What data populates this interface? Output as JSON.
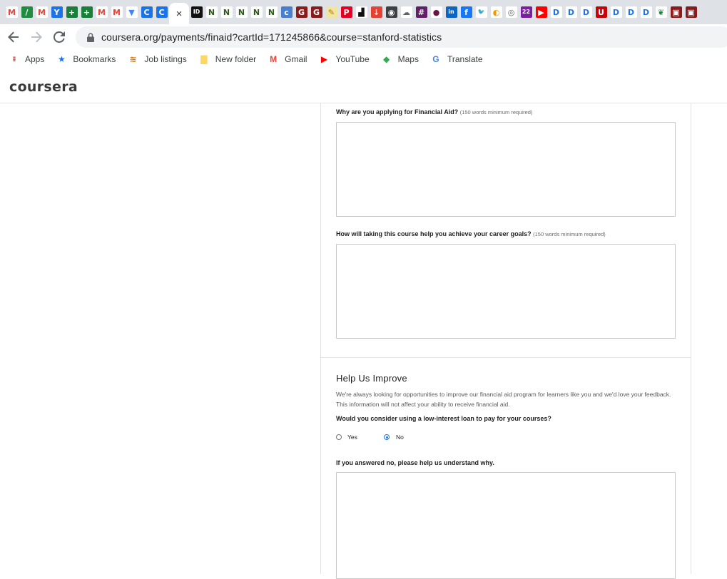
{
  "browser": {
    "tabs": [
      {
        "icon": "gmail-icon",
        "glyph": "M",
        "bg": "#ffffff",
        "fg": "#ea4335"
      },
      {
        "icon": "pen-icon",
        "glyph": "/",
        "bg": "#1e8e3e",
        "fg": "#ffffff"
      },
      {
        "icon": "gmail-icon",
        "glyph": "M",
        "bg": "#ffffff",
        "fg": "#ea4335"
      },
      {
        "icon": "y-icon",
        "glyph": "Y",
        "bg": "#1a73e8",
        "fg": "#ffffff"
      },
      {
        "icon": "plus-green-icon",
        "glyph": "+",
        "bg": "#188038",
        "fg": "#ffffff"
      },
      {
        "icon": "plus-green-icon",
        "glyph": "+",
        "bg": "#188038",
        "fg": "#ffffff"
      },
      {
        "icon": "gmail-icon",
        "glyph": "M",
        "bg": "#ffffff",
        "fg": "#ea4335"
      },
      {
        "icon": "gmail-icon",
        "glyph": "M",
        "bg": "#ffffff",
        "fg": "#ea4335"
      },
      {
        "icon": "shield-icon",
        "glyph": "▼",
        "bg": "#ffffff",
        "fg": "#4285f4"
      },
      {
        "icon": "c-circle-icon",
        "glyph": "C",
        "bg": "#1a73e8",
        "fg": "#ffffff"
      },
      {
        "icon": "c-circle-icon",
        "glyph": "C",
        "bg": "#1a73e8",
        "fg": "#ffffff"
      }
    ],
    "active_tab_close": "×",
    "tabs_after": [
      {
        "icon": "id-icon",
        "glyph": "ID",
        "bg": "#111111",
        "fg": "#ffffff"
      },
      {
        "icon": "n-icon",
        "glyph": "N",
        "bg": "#ffffff",
        "fg": "#2d5a1b"
      },
      {
        "icon": "n-icon",
        "glyph": "N",
        "bg": "#ffffff",
        "fg": "#2d5a1b"
      },
      {
        "icon": "n-icon",
        "glyph": "N",
        "bg": "#ffffff",
        "fg": "#2d5a1b"
      },
      {
        "icon": "n-icon",
        "glyph": "N",
        "bg": "#ffffff",
        "fg": "#2d5a1b"
      },
      {
        "icon": "n-icon",
        "glyph": "N",
        "bg": "#ffffff",
        "fg": "#2d5a1b"
      },
      {
        "icon": "c-circle-icon",
        "glyph": "c",
        "bg": "#4a7fd0",
        "fg": "#ffffff"
      },
      {
        "icon": "g-icon",
        "glyph": "G",
        "bg": "#8b1a1a",
        "fg": "#ffffff"
      },
      {
        "icon": "g-icon",
        "glyph": "G",
        "bg": "#8b1a1a",
        "fg": "#ffffff"
      },
      {
        "icon": "note-icon",
        "glyph": "✎",
        "bg": "#f2e5a0",
        "fg": "#b07b00"
      },
      {
        "icon": "pinterest-icon",
        "glyph": "P",
        "bg": "#e60023",
        "fg": "#ffffff"
      },
      {
        "icon": "box-icon",
        "glyph": "▟",
        "bg": "#ffffff",
        "fg": "#111111"
      },
      {
        "icon": "download-icon",
        "glyph": "↓",
        "bg": "#e34133",
        "fg": "#ffffff"
      },
      {
        "icon": "robot-icon",
        "glyph": "◉",
        "bg": "#3c4043",
        "fg": "#ffffff"
      },
      {
        "icon": "cloud-icon",
        "glyph": "☁",
        "bg": "#ffffff",
        "fg": "#5f6368"
      },
      {
        "icon": "slack-icon",
        "glyph": "#",
        "bg": "#611f69",
        "fg": "#ffffff"
      },
      {
        "icon": "circle-icon",
        "glyph": "●",
        "bg": "#ffffff",
        "fg": "#6b1446"
      },
      {
        "icon": "linkedin-icon",
        "glyph": "in",
        "bg": "#0a66c2",
        "fg": "#ffffff"
      },
      {
        "icon": "facebook-icon",
        "glyph": "f",
        "bg": "#1877f2",
        "fg": "#ffffff"
      },
      {
        "icon": "twitter-icon",
        "glyph": "🐦",
        "bg": "#ffffff",
        "fg": "#1d9bf0"
      },
      {
        "icon": "coin-icon",
        "glyph": "◐",
        "bg": "#ffffff",
        "fg": "#f29900"
      },
      {
        "icon": "globe-icon",
        "glyph": "◎",
        "bg": "#ffffff",
        "fg": "#5f6368"
      },
      {
        "icon": "badge-22-icon",
        "glyph": "22",
        "bg": "#7b1fa2",
        "fg": "#ffffff"
      },
      {
        "icon": "youtube-icon",
        "glyph": "▶",
        "bg": "#ff0000",
        "fg": "#ffffff"
      },
      {
        "icon": "d-icon",
        "glyph": "D",
        "bg": "#ffffff",
        "fg": "#1a73e8"
      },
      {
        "icon": "d-icon",
        "glyph": "D",
        "bg": "#ffffff",
        "fg": "#1a73e8"
      },
      {
        "icon": "d-icon",
        "glyph": "D",
        "bg": "#ffffff",
        "fg": "#1a73e8"
      },
      {
        "icon": "u-icon",
        "glyph": "U",
        "bg": "#c5050c",
        "fg": "#ffffff"
      },
      {
        "icon": "d-icon",
        "glyph": "D",
        "bg": "#ffffff",
        "fg": "#1a73e8"
      },
      {
        "icon": "d-icon",
        "glyph": "D",
        "bg": "#ffffff",
        "fg": "#1a73e8"
      },
      {
        "icon": "d-icon",
        "glyph": "D",
        "bg": "#ffffff",
        "fg": "#1a73e8"
      },
      {
        "icon": "leaf-icon",
        "glyph": "❦",
        "bg": "#ffffff",
        "fg": "#188038"
      },
      {
        "icon": "square-red-icon",
        "glyph": "▣",
        "bg": "#8b1a1a",
        "fg": "#ffffff"
      },
      {
        "icon": "square-red-icon",
        "glyph": "▣",
        "bg": "#8b1a1a",
        "fg": "#ffffff"
      }
    ],
    "url": "coursera.org/payments/finaid?cartId=171245866&course=stanford-statistics",
    "bookmarks": [
      {
        "label": "Apps",
        "icon": "apps-grid-icon",
        "glyph": "⁞⁞⁞",
        "color": "#ea4335"
      },
      {
        "label": "Bookmarks",
        "icon": "star-icon",
        "glyph": "★",
        "color": "#1a73e8"
      },
      {
        "label": "Job listings",
        "icon": "stripes-icon",
        "glyph": "≋",
        "color": "#e37400"
      },
      {
        "label": "New folder",
        "icon": "folder-icon",
        "glyph": "▇",
        "color": "#fdd663"
      },
      {
        "label": "Gmail",
        "icon": "gmail-icon",
        "glyph": "M",
        "color": "#ea4335"
      },
      {
        "label": "YouTube",
        "icon": "youtube-icon",
        "glyph": "▶",
        "color": "#ff0000"
      },
      {
        "label": "Maps",
        "icon": "maps-icon",
        "glyph": "◆",
        "color": "#34a853"
      },
      {
        "label": "Translate",
        "icon": "translate-icon",
        "glyph": "G",
        "color": "#4285f4"
      }
    ]
  },
  "site": {
    "logo": "coursera"
  },
  "form": {
    "q1": {
      "label": "Why are you applying for Financial Aid?",
      "hint": "(150 words minimum required)",
      "value": ""
    },
    "q2": {
      "label": "How will taking this course help you achieve your career goals?",
      "hint": "(150 words minimum required)",
      "value": ""
    },
    "improve": {
      "title": "Help Us Improve",
      "description": "We're always looking for opportunities to improve our financial aid program for learners like you and we'd love your feedback. This information will not affect your ability to receive financial aid.",
      "loan_question": "Would you consider using a low-interest loan to pay for your courses?",
      "options": [
        {
          "label": "Yes",
          "checked": false
        },
        {
          "label": "No",
          "checked": true
        }
      ],
      "why_label": "If you answered no, please help us understand why.",
      "why_value": ""
    }
  }
}
